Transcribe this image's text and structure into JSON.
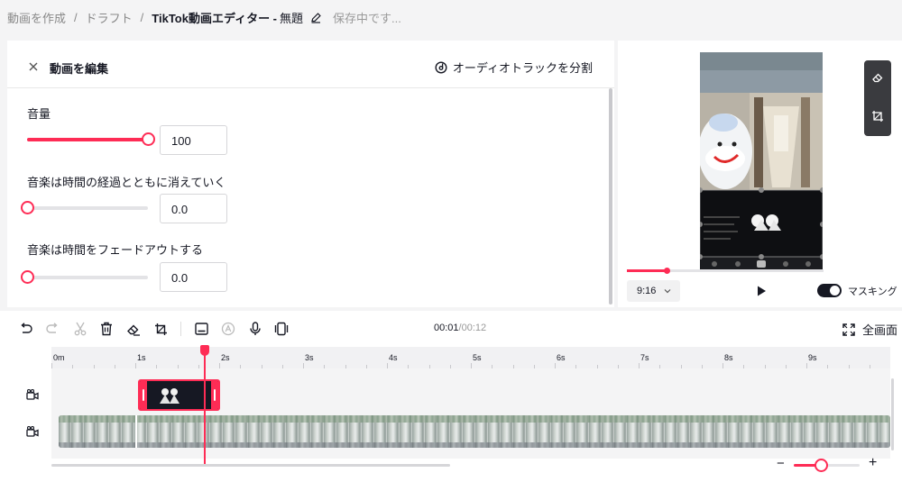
{
  "breadcrumb": {
    "create": "動画を作成",
    "drafts": "ドラフト",
    "editor_name": "TikTok動画エディター -",
    "draft_name": "無題",
    "saving": "保存中です..."
  },
  "panel": {
    "title": "動画を編集",
    "split_audio": "オーディオトラックを分割",
    "volume": {
      "label": "音量",
      "value": "100",
      "level": 1.0
    },
    "fade_in": {
      "label": "音楽は時間の経過とともに消えていく",
      "value": "0.0",
      "level": 0.0
    },
    "fade_out": {
      "label": "音楽は時間をフェードアウトする",
      "value": "0.0",
      "level": 0.0
    }
  },
  "preview": {
    "ratio": "9:16",
    "masking_label": "マスキング",
    "masking_on": true,
    "progress": 0.2
  },
  "toolbar": {
    "timecode_current": "00:01",
    "timecode_total": "/00:12",
    "fullscreen_label": "全画面"
  },
  "timeline": {
    "ticks": [
      "0m",
      "1s",
      "2s",
      "3s",
      "4s",
      "5s",
      "6s",
      "7s",
      "8s",
      "9s"
    ],
    "zoom_level": 0.41
  },
  "colors": {
    "accent": "#fe2c55",
    "text": "#161823",
    "muted": "#888888"
  },
  "icons": [
    "close-icon",
    "split-audio-icon",
    "pencil-icon",
    "undo-icon",
    "redo-icon",
    "cut-icon",
    "delete-icon",
    "eraser-icon",
    "crop-icon",
    "caption-icon",
    "text-to-speech-icon",
    "microphone-icon",
    "frame-icon",
    "fullscreen-icon",
    "play-icon",
    "video-track-icon"
  ]
}
